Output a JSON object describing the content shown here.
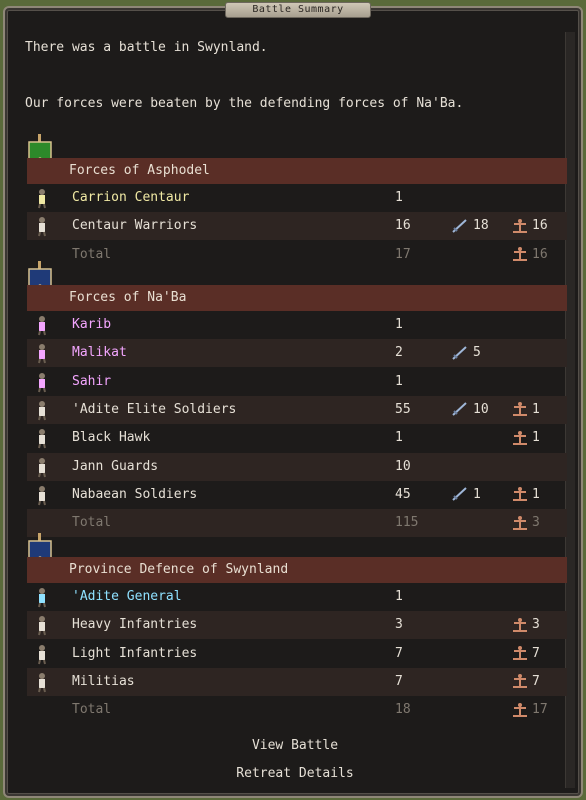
{
  "window": {
    "title": "Battle Summary"
  },
  "intro": {
    "line1": "There was a battle in Swynland.",
    "line2": "Our forces were beaten by the defending forces of Na'Ba."
  },
  "groups": [
    {
      "title": "Forces of Asphodel",
      "banner_color": "#2d8a2a",
      "rows": [
        {
          "name": "Carrion Centaur",
          "color": "#f0e9a4",
          "count": "1",
          "attack": "",
          "casualties": ""
        },
        {
          "name": "Centaur Warriors",
          "color": "#e6e0d6",
          "count": "16",
          "attack": "18",
          "casualties": "16"
        }
      ],
      "total": {
        "label": "Total",
        "count": "17",
        "casualties": "16"
      }
    },
    {
      "title": "Forces of Na'Ba",
      "banner_color": "#1f3a78",
      "rows": [
        {
          "name": "Karib",
          "color": "#f4a6ff",
          "count": "1",
          "attack": "",
          "casualties": ""
        },
        {
          "name": "Malikat",
          "color": "#f4a6ff",
          "count": "2",
          "attack": "5",
          "casualties": ""
        },
        {
          "name": "Sahir",
          "color": "#f4a6ff",
          "count": "1",
          "attack": "",
          "casualties": ""
        },
        {
          "name": "'Adite Elite Soldiers",
          "color": "#e6e0d6",
          "count": "55",
          "attack": "10",
          "casualties": "1"
        },
        {
          "name": "Black Hawk",
          "color": "#e6e0d6",
          "count": "1",
          "attack": "",
          "casualties": "1"
        },
        {
          "name": "Jann Guards",
          "color": "#e6e0d6",
          "count": "10",
          "attack": "",
          "casualties": ""
        },
        {
          "name": "Nabaean Soldiers",
          "color": "#e6e0d6",
          "count": "45",
          "attack": "1",
          "casualties": "1"
        }
      ],
      "total": {
        "label": "Total",
        "count": "115",
        "casualties": "3"
      }
    },
    {
      "title": "Province Defence of Swynland",
      "banner_color": "#1f3a78",
      "rows": [
        {
          "name": "'Adite General",
          "color": "#8fe1ff",
          "count": "1",
          "attack": "",
          "casualties": ""
        },
        {
          "name": "Heavy Infantries",
          "color": "#e6e0d6",
          "count": "3",
          "attack": "",
          "casualties": "3"
        },
        {
          "name": "Light Infantries",
          "color": "#e6e0d6",
          "count": "7",
          "attack": "",
          "casualties": "7"
        },
        {
          "name": "Militias",
          "color": "#e6e0d6",
          "count": "7",
          "attack": "",
          "casualties": "7"
        }
      ],
      "total": {
        "label": "Total",
        "count": "18",
        "casualties": "17"
      }
    }
  ],
  "icons": {
    "attack": "sword-icon",
    "casualties": "casualty-icon"
  },
  "buttons": {
    "view_battle": "View Battle",
    "retreat_details": "Retreat Details"
  }
}
